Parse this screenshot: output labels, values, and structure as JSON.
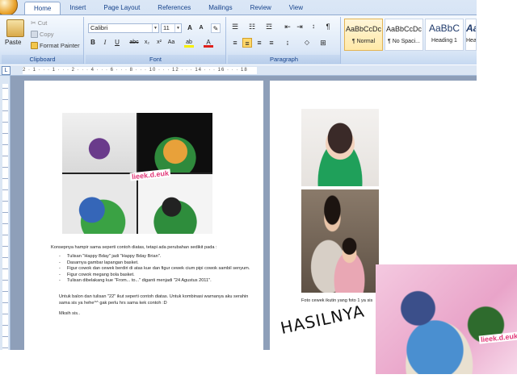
{
  "ribbon": {
    "tabs": [
      "Home",
      "Insert",
      "Page Layout",
      "References",
      "Mailings",
      "Review",
      "View"
    ],
    "clipboard": {
      "paste_label": "Paste",
      "cut_label": "Cut",
      "copy_label": "Copy",
      "format_painter_label": "Format Painter",
      "group_label": "Clipboard"
    },
    "font": {
      "font_name": "Calibri",
      "font_size": "11",
      "group_label": "Font"
    },
    "paragraph": {
      "group_label": "Paragraph"
    },
    "styles": [
      {
        "sample": "AaBbCcDc",
        "name": "¶ Normal"
      },
      {
        "sample": "AaBbCcDc",
        "name": "¶ No Spaci..."
      },
      {
        "sample": "AaBbC",
        "name": "Heading 1"
      },
      {
        "sample": "Aa",
        "name": "Hea"
      }
    ]
  },
  "ruler": {
    "corner": "L",
    "marks": "2 · 1 · · · 1 · · · 2 · · · 4 · · · 6 · · · 8 · · · 10 · · · 12 · · · 14 · · · 16 · · · 18"
  },
  "document": {
    "collage_tag": "lieek.d.euk",
    "intro": "Konsepnya hampir sama seperti contoh diatas, tetapi ada perubahan sedikit pada :",
    "bullets": [
      "Tulisan \"Happy Bday\" jadi \"Happy Bday Brian\".",
      "Dasarnya gambar lapangan basket.",
      "Figur cowok dan cewek berdiri di atas kue dan figur cewek cium pipi cowok sambil senyum.",
      "Figur cowok megang bola basket.",
      "Tulisan dibelakang kue \"From... to...\" diganti menjadi \"24 Agustus 2011\"."
    ],
    "balloon_note": "Untuk balon dan tulisan \"22\" ikut seperti contoh diatas. Untuk kombinasi warnanya aku serahin sama sis ya hehe^^ gak perlu hrs sama kek contoh :D",
    "closing": "Mksih sis..",
    "photo_caption": "Foto cewek ikutin yang foto 1 ya sis"
  },
  "overlay": {
    "hasil_text": "HASILNYA",
    "result_tag": "lieek.d.euk"
  }
}
